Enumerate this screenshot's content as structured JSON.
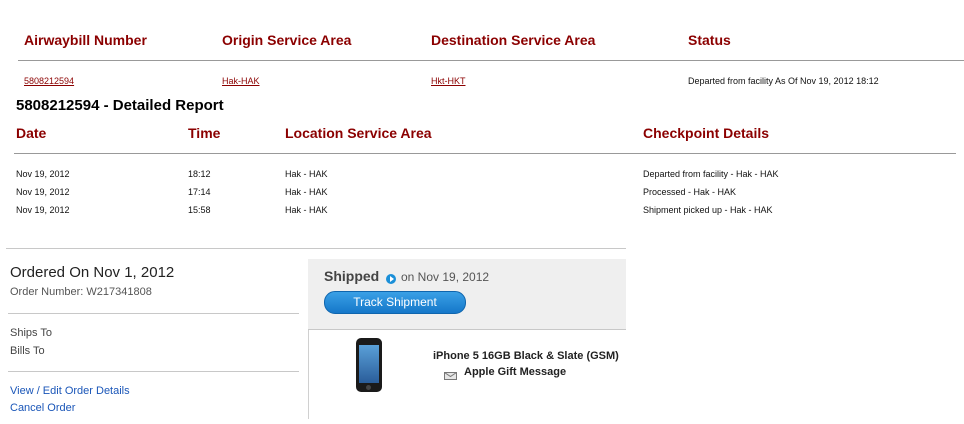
{
  "shipment": {
    "headers": {
      "awb": "Airwaybill Number",
      "origin": "Origin Service Area",
      "destination": "Destination Service Area",
      "status": "Status"
    },
    "row": {
      "awb": "5808212594",
      "origin": "Hak-HAK",
      "destination": "Hkt-HKT",
      "status": "Departed from facility As Of Nov 19, 2012 18:12"
    }
  },
  "report": {
    "title": "5808212594 - Detailed Report",
    "headers": {
      "date": "Date",
      "time": "Time",
      "location": "Location Service Area",
      "checkpoint": "Checkpoint Details"
    },
    "rows": [
      {
        "date": "Nov 19, 2012",
        "time": "18:12",
        "location": "Hak - HAK",
        "checkpoint": "Departed from facility - Hak - HAK"
      },
      {
        "date": "Nov 19, 2012",
        "time": "17:14",
        "location": "Hak - HAK",
        "checkpoint": "Processed - Hak - HAK"
      },
      {
        "date": "Nov 19, 2012",
        "time": "15:58",
        "location": "Hak - HAK",
        "checkpoint": "Shipment picked up - Hak - HAK"
      }
    ]
  },
  "order": {
    "ordered_on": "Ordered On Nov 1, 2012",
    "order_number": "Order Number: W217341808",
    "ships_to_label": "Ships To",
    "bills_to_label": "Bills To",
    "view_edit_link": "View / Edit Order Details",
    "cancel_link": "Cancel Order",
    "shipped_label": "Shipped",
    "shipped_date": "on Nov 19, 2012",
    "track_button": "Track Shipment",
    "product_name": "iPhone 5 16GB Black & Slate (GSM)",
    "gift_message": "Apple Gift Message"
  },
  "colors": {
    "header_red": "#8b0000",
    "link_blue": "#1a56b8",
    "button_blue": "#1577c9"
  },
  "icons": [
    "play-circle-icon",
    "envelope-icon",
    "iphone-image"
  ]
}
